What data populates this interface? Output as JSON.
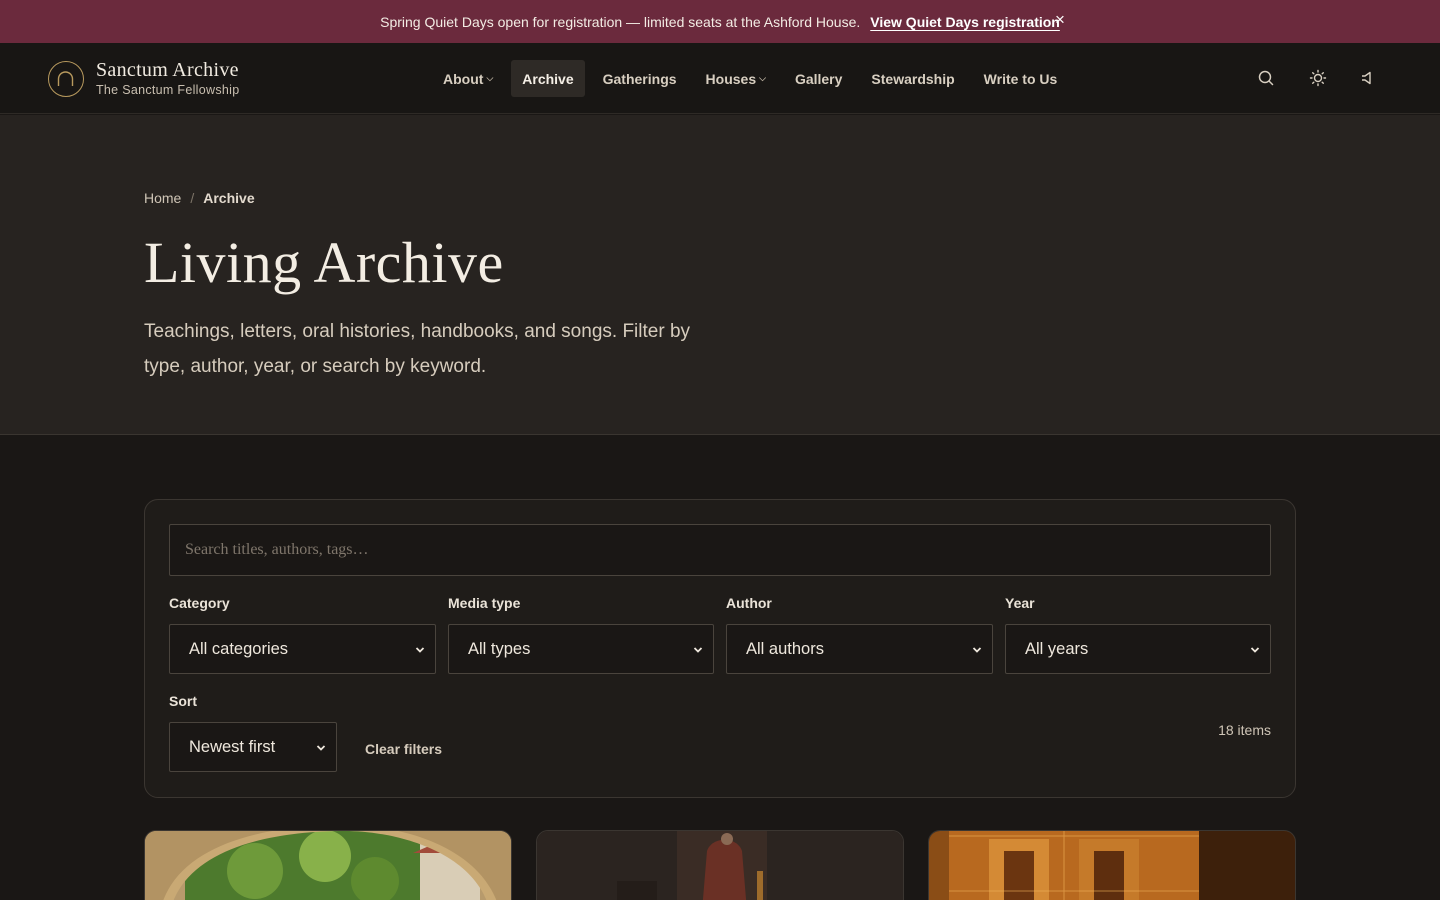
{
  "announcement": {
    "message": "Spring Quiet Days open for registration — limited seats at the Ashford House.",
    "link_label": "View Quiet Days registration",
    "close_label": "×"
  },
  "brand": {
    "title": "Sanctum Archive",
    "subtitle": "The Sanctum Fellowship"
  },
  "nav": {
    "items": [
      {
        "label": "About",
        "has_dropdown": true
      },
      {
        "label": "Archive",
        "active": true
      },
      {
        "label": "Gatherings"
      },
      {
        "label": "Houses",
        "has_dropdown": true
      },
      {
        "label": "Gallery"
      },
      {
        "label": "Stewardship"
      },
      {
        "label": "Write to Us"
      }
    ],
    "chevron": "⌵"
  },
  "header_icons": [
    "search-icon",
    "sun-icon",
    "speaker-icon"
  ],
  "breadcrumb": {
    "home": "Home",
    "separator": "/",
    "current": "Archive"
  },
  "hero": {
    "title": "Living Archive",
    "description": "Teachings, letters, oral histories, handbooks, and songs. Filter by type, author, year, or search by keyword."
  },
  "filters": {
    "search_placeholder": "Search titles, authors, tags…",
    "category": {
      "label": "Category",
      "value": "All categories"
    },
    "media_type": {
      "label": "Media type",
      "value": "All types"
    },
    "author": {
      "label": "Author",
      "value": "All authors"
    },
    "year": {
      "label": "Year",
      "value": "All years"
    },
    "sort": {
      "label": "Sort",
      "value": "Newest first"
    },
    "clear_label": "Clear filters",
    "count": "18 items"
  },
  "colors": {
    "announcement_bg": "#6b2a3d",
    "header_bg": "#181614",
    "hero_bg": "#272320",
    "page_bg": "#1a1715",
    "accent_gold": "#b89a5e"
  }
}
